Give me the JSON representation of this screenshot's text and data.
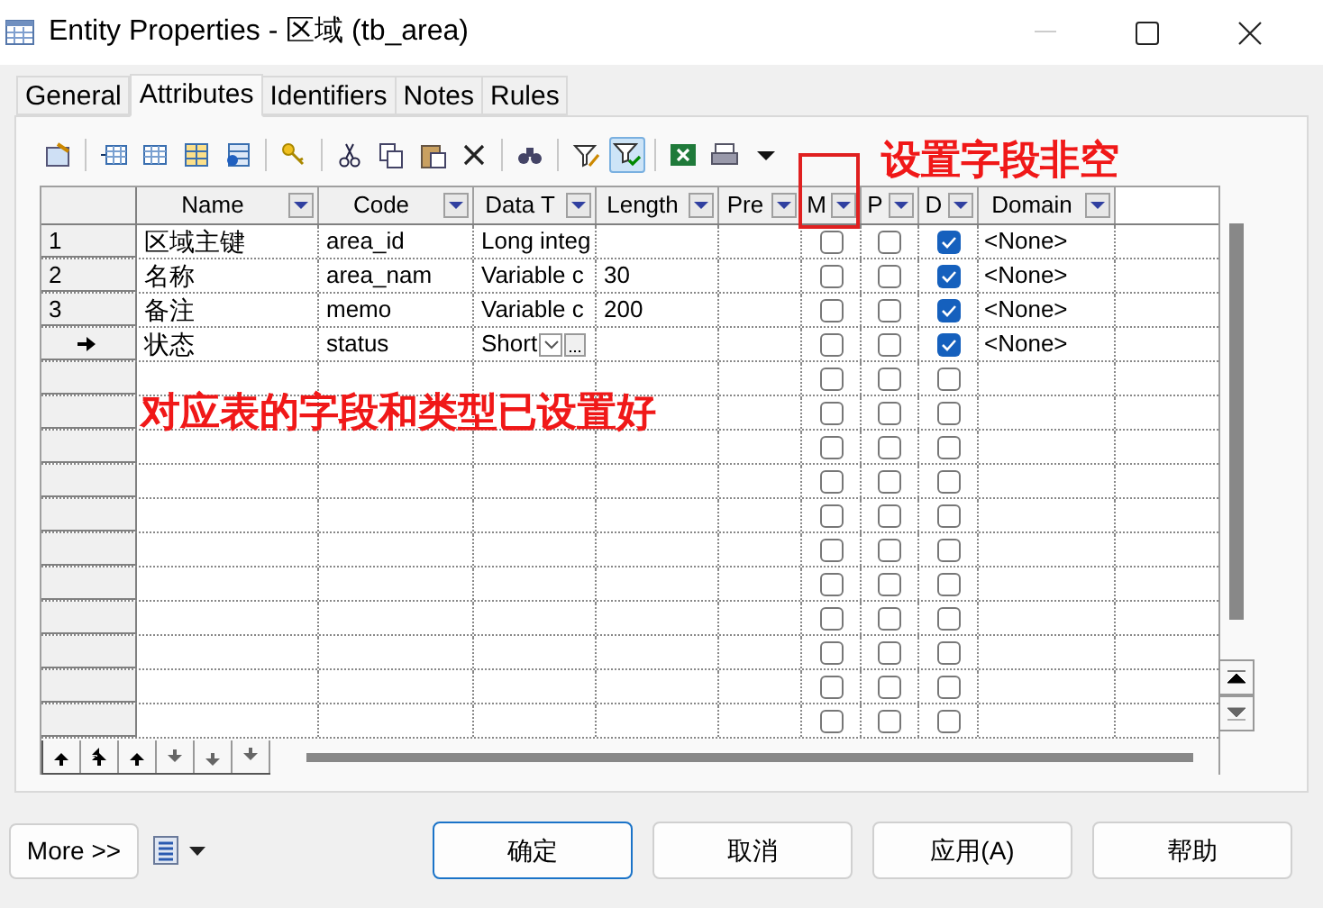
{
  "window": {
    "title": "Entity Properties - 区域 (tb_area)"
  },
  "tabs": [
    {
      "label": "General",
      "selected": false
    },
    {
      "label": "Attributes",
      "selected": true
    },
    {
      "label": "Identifiers",
      "selected": false
    },
    {
      "label": "Notes",
      "selected": false
    },
    {
      "label": "Rules",
      "selected": false
    }
  ],
  "toolbar": [
    {
      "kind": "properties",
      "pressed": false
    },
    {
      "kind": "sep"
    },
    {
      "kind": "insert",
      "pressed": false
    },
    {
      "kind": "add",
      "pressed": false
    },
    {
      "kind": "addcols",
      "pressed": false
    },
    {
      "kind": "reuse",
      "pressed": false
    },
    {
      "kind": "sep"
    },
    {
      "kind": "key",
      "pressed": false
    },
    {
      "kind": "sep"
    },
    {
      "kind": "cut",
      "pressed": false
    },
    {
      "kind": "copy",
      "pressed": false
    },
    {
      "kind": "paste",
      "pressed": false
    },
    {
      "kind": "delete",
      "pressed": false
    },
    {
      "kind": "sep"
    },
    {
      "kind": "find",
      "pressed": false
    },
    {
      "kind": "sep"
    },
    {
      "kind": "filter",
      "pressed": false
    },
    {
      "kind": "filtercheck",
      "pressed": true
    },
    {
      "kind": "sep"
    },
    {
      "kind": "excel",
      "pressed": false
    },
    {
      "kind": "print",
      "pressed": false
    },
    {
      "kind": "caret",
      "pressed": false
    }
  ],
  "table": {
    "columns": [
      "Name",
      "Code",
      "Data T",
      "Length",
      "Pre",
      "M",
      "P",
      "D",
      "Domain"
    ],
    "rows": [
      {
        "number": "1",
        "current": false,
        "name": "区域主键",
        "code": "area_id",
        "data_type": "Long integ",
        "mandatory": false,
        "primary": false,
        "displayed": true,
        "domain": "<None>"
      },
      {
        "number": "2",
        "current": false,
        "name": "名称",
        "code": "area_nam",
        "data_type": "Variable c",
        "length": "30",
        "mandatory": false,
        "primary": false,
        "displayed": true,
        "domain": "<None>"
      },
      {
        "number": "3",
        "current": false,
        "name": "备注",
        "code": "memo",
        "data_type": "Variable c",
        "length": "200",
        "mandatory": false,
        "primary": false,
        "displayed": true,
        "domain": "<None>"
      },
      {
        "current": true,
        "name": "状态",
        "code": "status",
        "data_type": "Short",
        "editing": true,
        "mandatory": false,
        "primary": false,
        "displayed": true,
        "domain": "<None>"
      },
      {
        "current": false,
        "mandatory": false,
        "primary": false,
        "displayed": false
      },
      {
        "current": false,
        "mandatory": false,
        "primary": false,
        "displayed": false
      },
      {
        "current": false,
        "mandatory": false,
        "primary": false,
        "displayed": false
      },
      {
        "current": false,
        "mandatory": false,
        "primary": false,
        "displayed": false
      },
      {
        "current": false,
        "mandatory": false,
        "primary": false,
        "displayed": false
      },
      {
        "current": false,
        "mandatory": false,
        "primary": false,
        "displayed": false
      },
      {
        "current": false,
        "mandatory": false,
        "primary": false,
        "displayed": false
      },
      {
        "current": false,
        "mandatory": false,
        "primary": false,
        "displayed": false
      },
      {
        "current": false,
        "mandatory": false,
        "primary": false,
        "displayed": false
      },
      {
        "current": false,
        "mandatory": false,
        "primary": false,
        "displayed": false
      },
      {
        "current": false,
        "mandatory": false,
        "primary": false,
        "displayed": false
      }
    ]
  },
  "annotations": [
    {
      "kind": "label",
      "text": "设置字段非空"
    },
    {
      "kind": "label",
      "text": "对应表的字段和类型已设置好"
    },
    {
      "kind": "box"
    }
  ],
  "buttons": [
    {
      "label": "More >>",
      "kind": "more"
    },
    {
      "label": "确定",
      "kind": "default"
    },
    {
      "label": "取消",
      "kind": "normal"
    },
    {
      "label": "应用(A)",
      "kind": "normal"
    },
    {
      "label": "帮助",
      "kind": "normal"
    }
  ]
}
